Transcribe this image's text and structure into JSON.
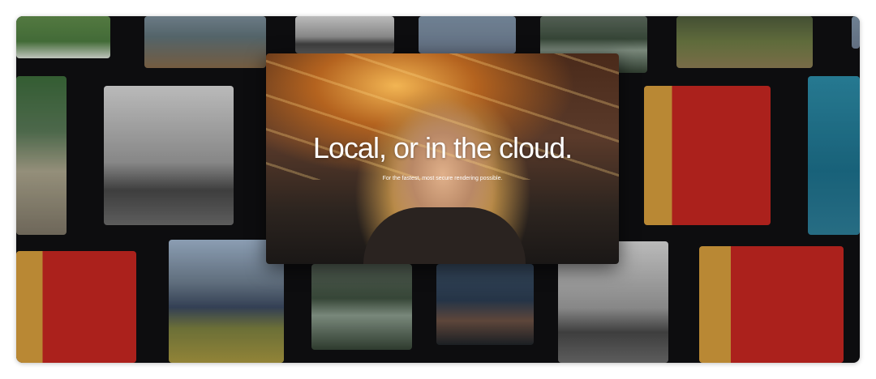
{
  "hero": {
    "title": "Local, or in the cloud.",
    "subtitle": "For the fastest, most secure rendering possible."
  }
}
